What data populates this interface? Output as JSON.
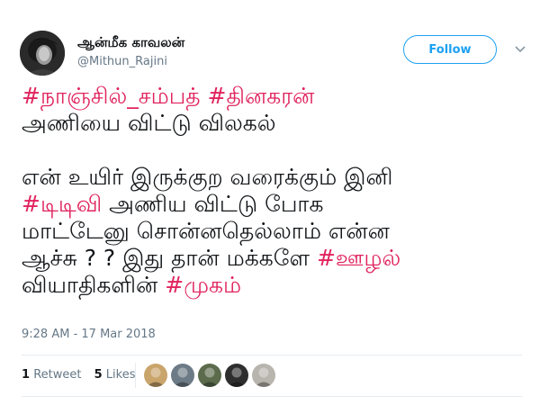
{
  "user": {
    "name": "ஆன்மீக காவலன்",
    "handle": "@Mithun_Rajini",
    "avatar_icon": "profile-photo-icon"
  },
  "follow_label": "Follow",
  "menu_icon": "chevron-down-icon",
  "tweet": {
    "lines": [
      [
        {
          "text": "#நாஞ்சில்_சம்பத் #தினகரன்",
          "tag": true
        }
      ],
      [
        {
          "text": "அணியை விட்டு விலகல்",
          "tag": false
        }
      ],
      [],
      [
        {
          "text": "என் உயிர் இருக்குற வரைக்கும் இனி",
          "tag": false
        }
      ],
      [
        {
          "text": "#டிடிவி",
          "tag": true
        },
        {
          "text": " அணிய விட்டு போக",
          "tag": false
        }
      ],
      [
        {
          "text": "மாட்டேனு சொன்னதெல்லாம் என்ன",
          "tag": false
        }
      ],
      [
        {
          "text": "ஆச்சு ? ? இது தான் மக்களே ",
          "tag": false
        },
        {
          "text": "#ஊழல்",
          "tag": true
        }
      ],
      [
        {
          "text": "வியாதிகளின் ",
          "tag": false
        },
        {
          "text": "#முகம்",
          "tag": true
        }
      ]
    ]
  },
  "timestamp": "9:28 AM - 17 Mar 2018",
  "stats": {
    "retweets_count": "1",
    "retweets_label": "Retweet",
    "likes_count": "5",
    "likes_label": "Likes"
  },
  "liker_avatars": [
    {
      "icon": "liker-avatar-icon",
      "color": "#c9a46b"
    },
    {
      "icon": "liker-avatar-icon",
      "color": "#6d7b86"
    },
    {
      "icon": "liker-avatar-icon",
      "color": "#5b6b4c"
    },
    {
      "icon": "liker-avatar-icon",
      "color": "#2e2e2e"
    },
    {
      "icon": "liker-avatar-icon",
      "color": "#b8b4ae"
    }
  ],
  "colors": {
    "hashtag": "#e0245e",
    "link": "#1da1f2",
    "muted": "#657786"
  }
}
